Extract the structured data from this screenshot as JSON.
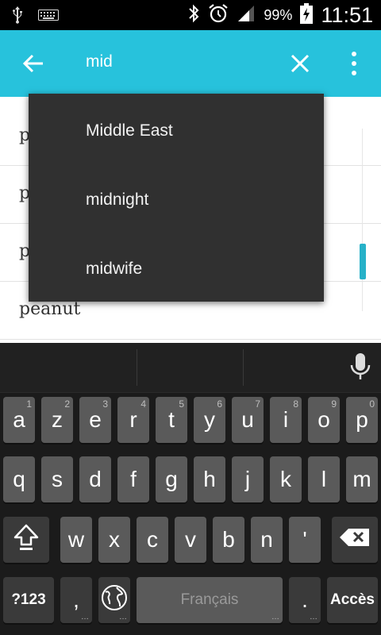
{
  "status": {
    "battery": "99%",
    "time": "11:51",
    "icons": [
      "usb-icon",
      "keyboard-icon",
      "bluetooth-icon",
      "alarm-icon",
      "signal-icon",
      "battery-icon"
    ]
  },
  "toolbar": {
    "query": "mid",
    "accent": "#27c2dc",
    "icons": [
      "back-arrow-icon",
      "close-icon",
      "overflow-menu-icon"
    ]
  },
  "list": {
    "rows": [
      "p",
      "p",
      "p",
      "peanut"
    ]
  },
  "suggestions": [
    "Middle East",
    "midnight",
    "midwife"
  ],
  "keyboard": {
    "row1": [
      {
        "label": "a",
        "hint": "1"
      },
      {
        "label": "z",
        "hint": "2"
      },
      {
        "label": "e",
        "hint": "3"
      },
      {
        "label": "r",
        "hint": "4"
      },
      {
        "label": "t",
        "hint": "5"
      },
      {
        "label": "y",
        "hint": "6"
      },
      {
        "label": "u",
        "hint": "7"
      },
      {
        "label": "i",
        "hint": "8"
      },
      {
        "label": "o",
        "hint": "9"
      },
      {
        "label": "p",
        "hint": "0"
      }
    ],
    "row2": [
      "q",
      "s",
      "d",
      "f",
      "g",
      "h",
      "j",
      "k",
      "l",
      "m"
    ],
    "row3": [
      "w",
      "x",
      "c",
      "v",
      "b",
      "n",
      "'"
    ],
    "symbols_label": "?123",
    "comma_label": ",",
    "space_label": "Français",
    "period_label": ".",
    "action_label": "Accès"
  }
}
